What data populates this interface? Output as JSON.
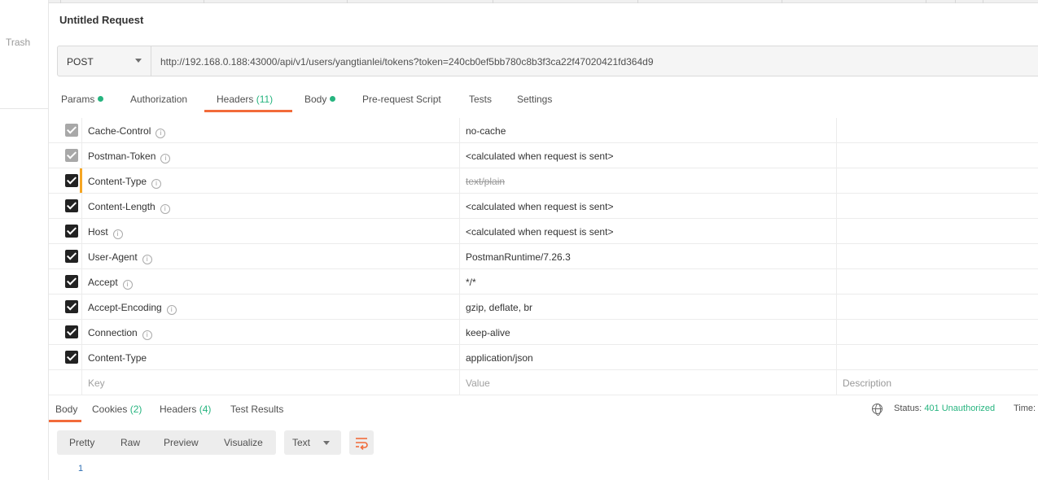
{
  "sidebar": {
    "trash_label": "Trash"
  },
  "request": {
    "title": "Untitled Request",
    "method": "POST",
    "url": "http://192.168.0.188:43000/api/v1/users/yangtianlei/tokens?token=240cb0ef5bb780c8b3f3ca22f47020421fd364d9"
  },
  "request_tabs": {
    "params": "Params",
    "authorization": "Authorization",
    "headers": "Headers",
    "headers_count": "(11)",
    "body": "Body",
    "prerequest": "Pre-request Script",
    "tests": "Tests",
    "settings": "Settings"
  },
  "headers": [
    {
      "key": "Cache-Control",
      "value": "no-cache",
      "checked": true,
      "disabled": true,
      "info": true
    },
    {
      "key": "Postman-Token",
      "value": "<calculated when request is sent>",
      "checked": true,
      "disabled": true,
      "info": true
    },
    {
      "key": "Content-Type",
      "value": "text/plain",
      "checked": true,
      "disabled": false,
      "info": true,
      "overridden": true
    },
    {
      "key": "Content-Length",
      "value": "<calculated when request is sent>",
      "checked": true,
      "disabled": false,
      "info": true
    },
    {
      "key": "Host",
      "value": "<calculated when request is sent>",
      "checked": true,
      "disabled": false,
      "info": true
    },
    {
      "key": "User-Agent",
      "value": "PostmanRuntime/7.26.3",
      "checked": true,
      "disabled": false,
      "info": true
    },
    {
      "key": "Accept",
      "value": "*/*",
      "checked": true,
      "disabled": false,
      "info": true
    },
    {
      "key": "Accept-Encoding",
      "value": "gzip, deflate, br",
      "checked": true,
      "disabled": false,
      "info": true
    },
    {
      "key": "Connection",
      "value": "keep-alive",
      "checked": true,
      "disabled": false,
      "info": true
    },
    {
      "key": "Content-Type",
      "value": "application/json",
      "checked": true,
      "disabled": false,
      "info": false
    }
  ],
  "headers_placeholder": {
    "key": "Key",
    "value": "Value",
    "description": "Description"
  },
  "response_tabs": {
    "body": "Body",
    "cookies": "Cookies",
    "cookies_count": "(2)",
    "headers": "Headers",
    "headers_count": "(4)",
    "test_results": "Test Results"
  },
  "status": {
    "label": "Status:",
    "code": "401 Unauthorized",
    "time_label": "Time:"
  },
  "view": {
    "pretty": "Pretty",
    "raw": "Raw",
    "preview": "Preview",
    "visualize": "Visualize",
    "format": "Text"
  },
  "editor": {
    "line": "1"
  },
  "colors": {
    "accent": "#f26b3a",
    "success": "#26b47f",
    "warning": "#f5a623"
  }
}
